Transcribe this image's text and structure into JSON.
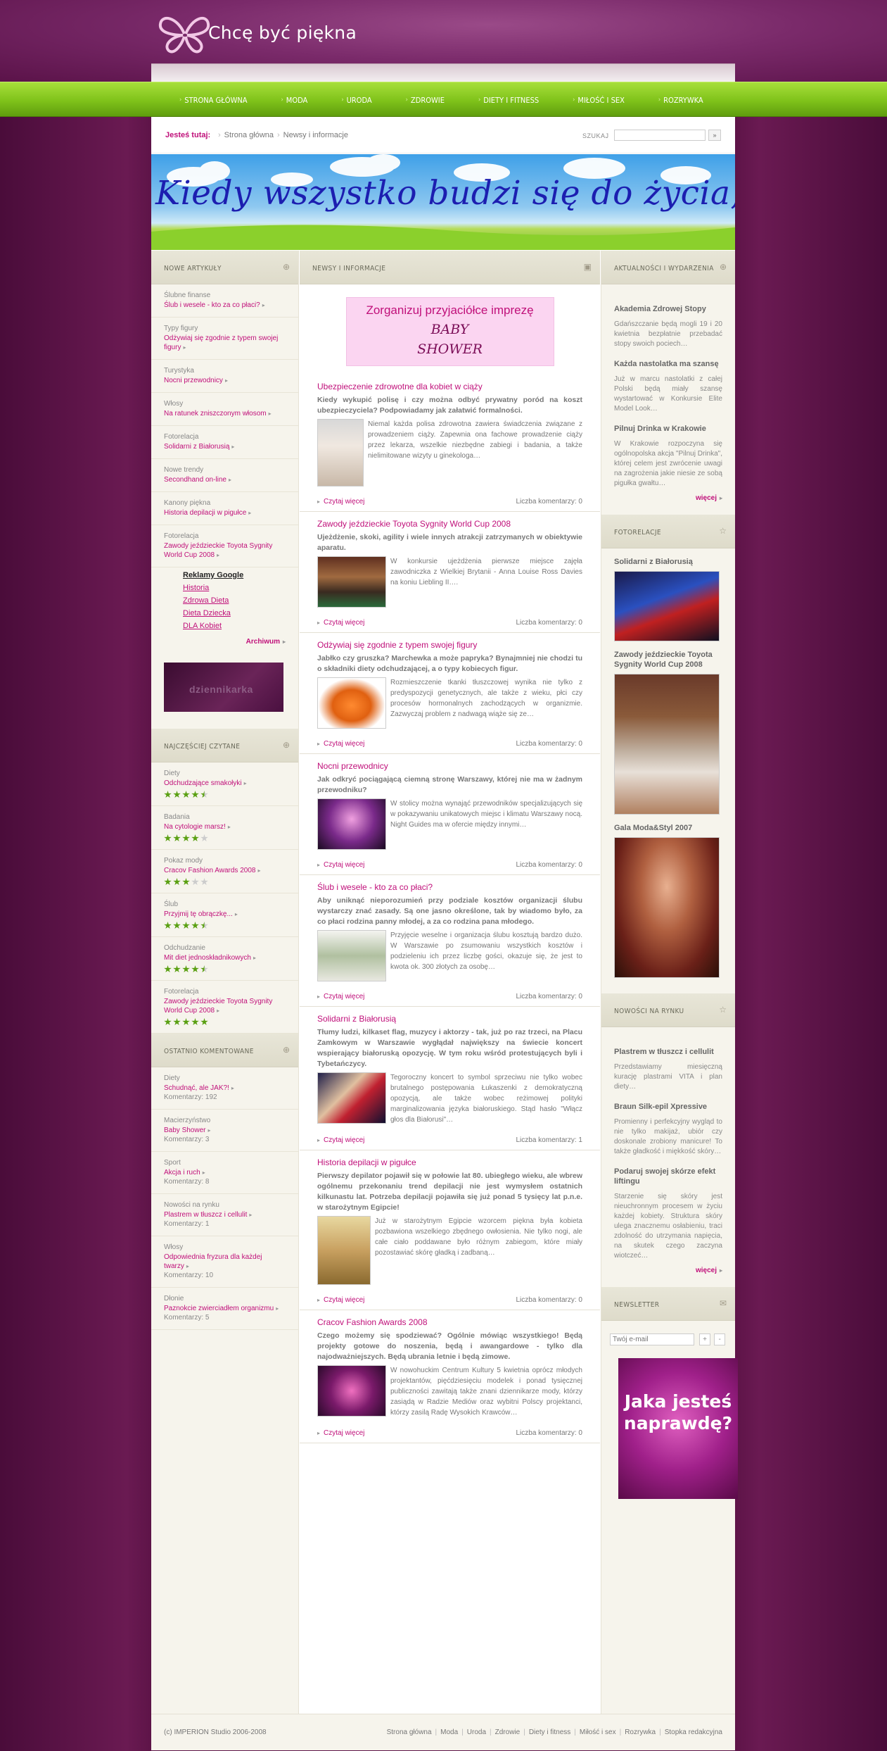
{
  "site": {
    "title": "Chcę być piękna"
  },
  "nav": [
    "STRONA GŁÓWNA",
    "MODA",
    "URODA",
    "ZDROWIE",
    "DIETY I FITNESS",
    "MIŁOŚĆ I SEX",
    "ROZRYWKA"
  ],
  "breadcrumb": {
    "label": "Jesteś tutaj:",
    "items": [
      "Strona główna",
      "Newsy i informacje"
    ]
  },
  "search": {
    "label": "SZUKAJ",
    "placeholder": "",
    "button": "»"
  },
  "banner": {
    "text": "Kiedy wszystko budzi się do życia,"
  },
  "left": {
    "new_title": "NOWE ARTYKUŁY",
    "new": [
      {
        "cat": "Ślubne finanse",
        "link": "Ślub i wesele - kto za co płaci?"
      },
      {
        "cat": "Typy figury",
        "link": "Odżywiaj się zgodnie z typem swojej figury"
      },
      {
        "cat": "Turystyka",
        "link": "Nocni przewodnicy"
      },
      {
        "cat": "Włosy",
        "link": "Na ratunek zniszczonym włosom"
      },
      {
        "cat": "Fotorelacja",
        "link": "Solidarni z Białorusią"
      },
      {
        "cat": "Nowe trendy",
        "link": "Secondhand on-line"
      },
      {
        "cat": "Kanony piękna",
        "link": "Historia depilacji w pigułce"
      },
      {
        "cat": "Fotorelacja",
        "link": "Zawody jeździeckie Toyota Sygnity World Cup 2008"
      }
    ],
    "ads_title": "Reklamy Google",
    "ads": [
      "Historia",
      "Zdrowa Dieta",
      "Dieta Dziecka",
      "DLA Kobiet"
    ],
    "archive": "Archiwum",
    "dzien": "dziennikarka",
    "read_title": "NAJCZĘŚCIEJ CZYTANE",
    "read": [
      {
        "cat": "Diety",
        "link": "Odchudzające smakołyki",
        "rating": 4.5
      },
      {
        "cat": "Badania",
        "link": "Na cytologie marsz!",
        "rating": 4
      },
      {
        "cat": "Pokaz mody",
        "link": "Cracov Fashion Awards 2008",
        "rating": 3
      },
      {
        "cat": "Ślub",
        "link": "Przyjmij tę obrączkę...",
        "rating": 4.5
      },
      {
        "cat": "Odchudzanie",
        "link": "Mit diet jednoskładnikowych",
        "rating": 4.5
      },
      {
        "cat": "Fotorelacja",
        "link": "Zawody jeździeckie Toyota Sygnity World Cup 2008",
        "rating": 5
      }
    ],
    "comm_title": "OSTATNIO KOMENTOWANE",
    "comm": [
      {
        "cat": "Diety",
        "link": "Schudnąć, ale JAK?!",
        "count": "Komentarzy: 192"
      },
      {
        "cat": "Macierzyństwo",
        "link": "Baby Shower",
        "count": "Komentarzy: 3"
      },
      {
        "cat": "Sport",
        "link": "Akcja i ruch",
        "count": "Komentarzy: 8"
      },
      {
        "cat": "Nowości na rynku",
        "link": "Plastrem w tłuszcz i cellulit",
        "count": "Komentarzy: 1"
      },
      {
        "cat": "Włosy",
        "link": "Odpowiednia fryzura dla każdej twarzy",
        "count": "Komentarzy: 10"
      },
      {
        "cat": "Dłonie",
        "link": "Paznokcie zwierciadłem organizmu",
        "count": "Komentarzy: 5"
      }
    ]
  },
  "mid": {
    "title": "NEWSY I INFORMACJE",
    "ad_line1": "Zorganizuj przyjaciółce imprezę",
    "ad_line2": "BABY",
    "ad_line3": "SHOWER",
    "read_more": "Czytaj więcej",
    "articles": [
      {
        "title": "Ubezpieczenie zdrowotne dla kobiet w ciąży",
        "lead": "Kiedy wykupić polisę i czy można odbyć prywatny poród na koszt ubezpieczyciela? Podpowiadamy jak załatwić formalności.",
        "text": "Niemal każda polisa zdrowotna zawiera świadczenia związane z prowadzeniem ciąży. Zapewnia ona fachowe prowadzenie ciąży przez lekarza, wszelkie niezbędne zabiegi i badania, a także nielimitowane wizyty u ginekologa…",
        "comments": "Liczba komentarzy: 0"
      },
      {
        "title": "Zawody jeździeckie Toyota Sygnity World Cup 2008",
        "lead": "Ujeżdżenie, skoki, agility i wiele innych atrakcji zatrzymanych w obiektywie aparatu.",
        "text": "W konkursie ujeżdżenia pierwsze miejsce zajęła zawodniczka z Wielkiej Brytanii - Anna Louise Ross Davies na koniu Liebling II….",
        "comments": "Liczba komentarzy: 0"
      },
      {
        "title": "Odżywiaj się zgodnie z typem swojej figury",
        "lead": "Jabłko czy gruszka? Marchewka a może papryka? Bynajmniej nie chodzi tu o składniki diety odchudzającej, a o typy kobiecych figur.",
        "text": "Rozmieszczenie tkanki tłuszczowej wynika nie tylko z predyspozycji genetycznych, ale także z wieku, płci czy procesów hormonalnych zachodzących w organizmie. Zazwyczaj problem z nadwagą wiąże się ze…",
        "comments": "Liczba komentarzy: 0"
      },
      {
        "title": "Nocni przewodnicy",
        "lead": "Jak odkryć pociągającą ciemną stronę Warszawy, której nie ma w żadnym przewodniku?",
        "text": "W stolicy można wynająć przewodników specjalizujących się w pokazywaniu unikatowych miejsc i klimatu Warszawy nocą. Night Guides ma w ofercie między innymi…",
        "comments": "Liczba komentarzy: 0"
      },
      {
        "title": "Ślub i wesele - kto za co płaci?",
        "lead": "Aby uniknąć nieporozumień przy podziale kosztów organizacji ślubu wystarczy znać zasady. Są one jasno określone, tak by wiadomo było, za co płaci rodzina panny młodej, a za co rodzina pana młodego.",
        "text": "Przyjęcie weselne i organizacja ślubu kosztują bardzo dużo. W Warszawie po zsumowaniu wszystkich kosztów i podzieleniu ich przez liczbę gości, okazuje się, że jest to kwota ok. 300 złotych za osobę…",
        "comments": "Liczba komentarzy: 0"
      },
      {
        "title": "Solidarni z Białorusią",
        "lead": "Tłumy ludzi, kilkaset flag, muzycy i aktorzy - tak, już po raz trzeci, na Placu Zamkowym w Warszawie wygłądał największy na świecie koncert wspierający białoruską opozycję. W tym roku wśród protestujących byli i Tybetańczycy.",
        "text": "Tegoroczny koncert to symbol sprzeciwu nie tylko wobec brutalnego postępowania Łukaszenki z demokratyczną opozycją, ale także wobec reżimowej polityki marginalizowania języka białoruskiego. Stąd hasło \"Włącz głos dla Białorusi\"…",
        "comments": "Liczba komentarzy: 1"
      },
      {
        "title": "Historia depilacji w pigułce",
        "lead": "Pierwszy depilator pojawił się w połowie lat 80. ubiegłego wieku, ale wbrew ogólnemu przekonaniu trend depilacji nie jest wymysłem ostatnich kilkunastu lat. Potrzeba depilacji pojawiła się już ponad 5 tysięcy lat p.n.e. w starożytnym Egipcie!",
        "text": "Już w starożytnym Egipcie wzorcem piękna była kobieta pozbawiona wszelkiego zbędnego owłosienia. Nie tylko nogi, ale całe ciało poddawane było różnym zabiegom, które miały pozostawiać skórę gładką i zadbaną…",
        "comments": "Liczba komentarzy: 0"
      },
      {
        "title": "Cracov Fashion Awards 2008",
        "lead": "Czego możemy się spodziewać? Ogólnie mówiąc wszystkiego! Będą projekty gotowe do noszenia, będą i awangardowe - tylko dla najodważniejszych. Będą ubrania letnie i będą zimowe.",
        "text": "W nowohuckim Centrum Kultury 5 kwietnia oprócz młodych projektantów, pięćdziesięciu modelek i ponad tysięcznej publiczności zawitają także znani dziennikarze mody, którzy zasiądą w Radzie Mediów oraz wybitni Polscy projektanci, którzy zasilą Radę Wysokich Krawców…",
        "comments": "Liczba komentarzy: 0"
      }
    ]
  },
  "right": {
    "news_title": "AKTUALNOŚCI I WYDARZENIA",
    "news": [
      {
        "title": "Akademia Zdrowej Stopy",
        "text": "Gdańszczanie będą mogli 19 i 20 kwietnia bezpłatnie przebadać stopy swoich pociech…"
      },
      {
        "title": "Każda nastolatka ma szansę",
        "text": "Już w marcu nastolatki z całej Polski będą miały szansę wystartować w Konkursie Elite Model Look…"
      },
      {
        "title": "Pilnuj Drinka w Krakowie",
        "text": "W Krakowie rozpoczyna się ogólnopolska akcja \"Pilnuj Drinka\", której celem jest zwrócenie uwagi na zagrożenia jakie niesie ze sobą pigułka gwałtu…"
      }
    ],
    "more": "więcej",
    "photo_title": "FOTORELACJE",
    "photos": [
      "Solidarni z Białorusią",
      "Zawody jeździeckie Toyota Sygnity World Cup 2008",
      "Gala Moda&Styl 2007"
    ],
    "market_title": "NOWOŚCI NA RYNKU",
    "market": [
      {
        "title": "Plastrem w tłuszcz i cellulit",
        "text": "Przedstawiamy miesięczną kurację plastrami VITA i plan diety…"
      },
      {
        "title": "Braun Silk-epil Xpressive",
        "text": "Promienny i perfekcyjny wygląd to nie tylko makijaż, ubiór czy doskonale zrobiony manicure! To także gładkość i miękkość skóry…"
      },
      {
        "title": "Podaruj swojej skórze efekt liftingu",
        "text": "Starzenie się skóry jest nieuchronnym procesem w życiu każdej kobiety. Struktura skóry ulega znacznemu osłabieniu, traci zdolność do utrzymania napięcia, na skutek czego zaczyna wiotczeć…"
      }
    ],
    "nl_title": "NEWSLETTER",
    "nl_placeholder": "Twój e-mail",
    "nl_plus": "+",
    "nl_minus": "-",
    "jaka": "Jaka jesteś naprawdę?"
  },
  "footer": {
    "copy": "(c) IMPERION Studio 2006-2008",
    "links": [
      "Strona główna",
      "Moda",
      "Uroda",
      "Zdrowie",
      "Diety i fitness",
      "Miłość i sex",
      "Rozrywka",
      "Stopka redakcyjna"
    ]
  }
}
